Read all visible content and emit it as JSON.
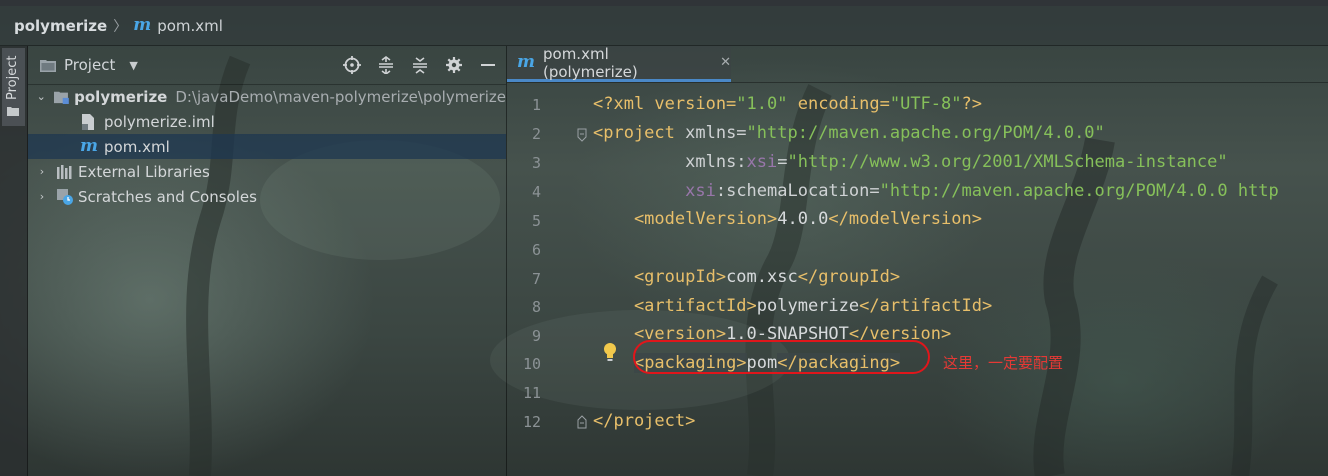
{
  "breadcrumb": {
    "project": "polymerize",
    "separator": "〉",
    "file": "pom.xml"
  },
  "tool_strip": {
    "tab_label": "Project"
  },
  "project_panel": {
    "title": "Project",
    "tree": [
      {
        "label": "polymerize",
        "path": "D:\\javaDemo\\maven-polymerize\\polymerize"
      },
      {
        "label": "polymerize.iml"
      },
      {
        "label": "pom.xml"
      },
      {
        "label": "External Libraries"
      },
      {
        "label": "Scratches and Consoles"
      }
    ]
  },
  "editor": {
    "tab_label": "pom.xml (polymerize)",
    "line_numbers": [
      "1",
      "2",
      "3",
      "4",
      "5",
      "6",
      "7",
      "8",
      "9",
      "10",
      "11",
      "12"
    ],
    "code": {
      "l1": {
        "a": "<?xml version=",
        "b": "\"1.0\"",
        "c": " encoding=",
        "d": "\"UTF-8\"",
        "e": "?>"
      },
      "l2": {
        "a": "<project ",
        "b": "xmlns=",
        "c": "\"http://maven.apache.org/POM/4.0.0\""
      },
      "l3": {
        "indent": "         ",
        "a": "xmlns:",
        "b": "xsi",
        "c": "=",
        "d": "\"http://www.w3.org/2001/XMLSchema-instance\""
      },
      "l4": {
        "indent": "         ",
        "a": "xsi",
        "b": ":schemaLocation=",
        "c": "\"http://maven.apache.org/POM/4.0.0 http"
      },
      "l5": {
        "open": "    <modelVersion>",
        "text": "4.0.0",
        "close": "</modelVersion>"
      },
      "l7": {
        "open": "    <groupId>",
        "text": "com.xsc",
        "close": "</groupId>"
      },
      "l8": {
        "open": "    <artifactId>",
        "text": "polymerize",
        "close": "</artifactId>"
      },
      "l9": {
        "open": "    <version>",
        "text": "1.0-SNAPSHOT",
        "close": "</version>"
      },
      "l10": {
        "indent": "    ",
        "open": "<packaging>",
        "text": "pom",
        "close": "</packaging>"
      },
      "l12": {
        "close": "</project>"
      }
    },
    "annotation": "这里，一定要配置"
  },
  "colors": {
    "tag": "#e8bf6a",
    "string": "#6a9f3c",
    "namespace": "#9876aa",
    "annotation": "#e53935",
    "selection": "#1e3750",
    "tab_underline": "#4a88c7"
  },
  "icons": [
    "folder-icon",
    "module-icon",
    "iml-file-icon",
    "maven-icon",
    "library-icon",
    "scratches-icon",
    "locate-icon",
    "expand-all-icon",
    "collapse-all-icon",
    "gear-icon",
    "minimize-icon",
    "lightbulb-icon",
    "close-icon"
  ]
}
